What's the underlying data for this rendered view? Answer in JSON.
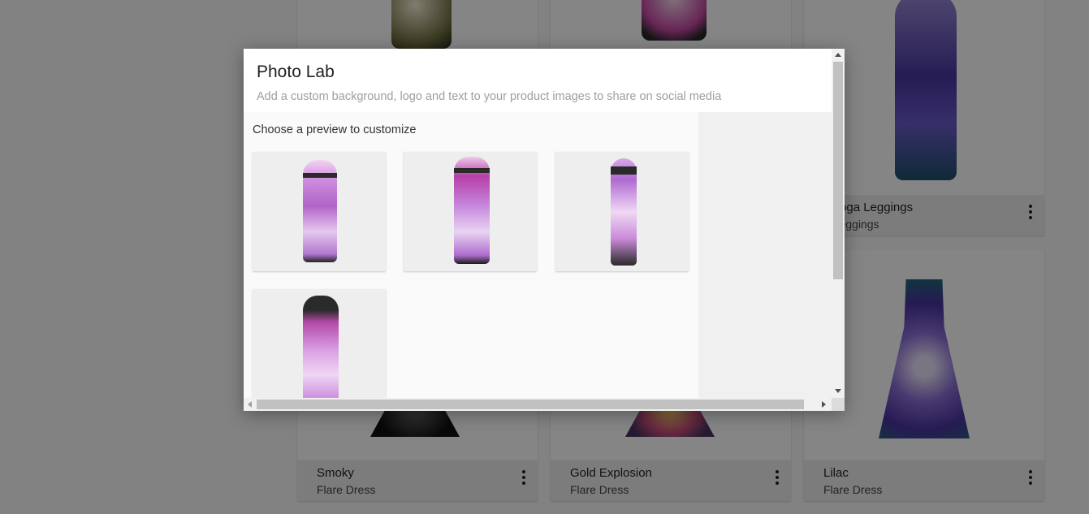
{
  "background": {
    "cards": [
      {
        "name": "",
        "subtitle": ""
      },
      {
        "name": "",
        "subtitle": ""
      },
      {
        "name": "c Yoga Leggings",
        "subtitle": "a Leggings"
      },
      {
        "name": "Smoky",
        "subtitle": "Flare Dress"
      },
      {
        "name": "Gold Explosion",
        "subtitle": "Flare Dress"
      },
      {
        "name": "Lilac",
        "subtitle": "Flare Dress"
      }
    ]
  },
  "modal": {
    "title": "Photo Lab",
    "subtitle": "Add a custom background, logo and text to your product images to share on social media",
    "choose_label": "Choose a preview to customize",
    "previews": [
      {
        "view": "front"
      },
      {
        "view": "back"
      },
      {
        "view": "side"
      },
      {
        "view": "front-low"
      }
    ]
  },
  "colors": {
    "overlay": "#000000",
    "pink_print": "#c98ad8",
    "purple_print": "#5a3fa8",
    "waistband": "#2a2a2a"
  },
  "icons": [
    "more-vert-icon",
    "scroll-up-arrow-icon",
    "scroll-down-arrow-icon",
    "scroll-left-arrow-icon",
    "scroll-right-arrow-icon"
  ]
}
